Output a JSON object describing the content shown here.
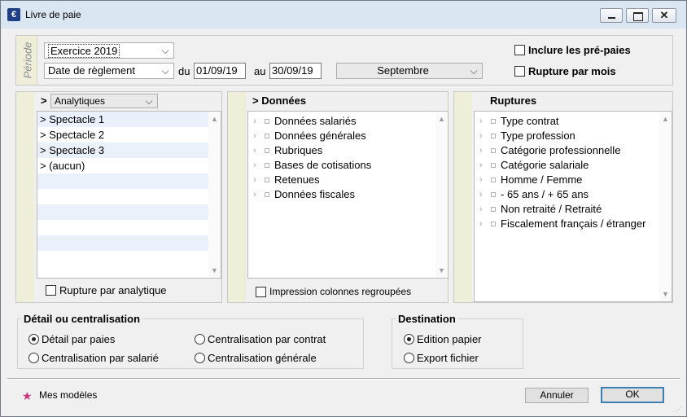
{
  "window": {
    "title": "Livre de paie",
    "app_icon": "€",
    "controls": {
      "minimize": "minimize-icon",
      "maximize": "maximize-icon",
      "close": "✕"
    }
  },
  "period": {
    "label": "Période",
    "exercise": "Exercice 2019",
    "date_type": "Date de règlement",
    "du_label": "du",
    "date_from": "01/09/19",
    "au_label": "au",
    "date_to": "30/09/19",
    "month": "Septembre",
    "include_prepaid": {
      "label": "Inclure les pré-paies",
      "checked": false
    },
    "break_by_month": {
      "label": "Rupture par mois",
      "checked": false
    }
  },
  "analytics": {
    "chevron": ">",
    "selector": "Analytiques",
    "items": [
      {
        "marker": ">",
        "label": "Spectacle 1"
      },
      {
        "marker": ">",
        "label": "Spectacle 2"
      },
      {
        "marker": ">",
        "label": "Spectacle 3"
      },
      {
        "marker": ">",
        "label": "(aucun)"
      }
    ],
    "break_checkbox": {
      "label": "Rupture par analytique",
      "checked": false
    }
  },
  "data_panel": {
    "chevron": ">",
    "title": "Données",
    "items": [
      "Données salariés",
      "Données générales",
      "Rubriques",
      "Bases de cotisations",
      "Retenues",
      "Données fiscales"
    ],
    "grouped_checkbox": {
      "label": "Impression colonnes regroupées",
      "checked": false
    }
  },
  "breaks_panel": {
    "title": "Ruptures",
    "items": [
      "Type contrat",
      "Type profession",
      "Catégorie professionnelle",
      "Catégorie salariale",
      "Homme / Femme",
      "- 65 ans / + 65 ans",
      "Non retraité / Retraité",
      "Fiscalement français / étranger"
    ]
  },
  "detail_group": {
    "title": "Détail ou centralisation",
    "options": [
      {
        "label": "Détail par paies",
        "selected": true
      },
      {
        "label": "Centralisation par contrat",
        "selected": false
      },
      {
        "label": "Centralisation par salarié",
        "selected": false
      },
      {
        "label": "Centralisation générale",
        "selected": false
      }
    ]
  },
  "destination_group": {
    "title": "Destination",
    "options": [
      {
        "label": "Edition papier",
        "selected": true
      },
      {
        "label": "Export fichier",
        "selected": false
      }
    ]
  },
  "footer": {
    "models_label": "Mes modèles",
    "cancel_label": "Annuler",
    "ok_label": "OK"
  },
  "colors": {
    "accent_strip": "#eeeed9",
    "list_alt_row": "#eaf1fb",
    "star": "#d0307a",
    "default_button_border": "#3c7fb1"
  }
}
